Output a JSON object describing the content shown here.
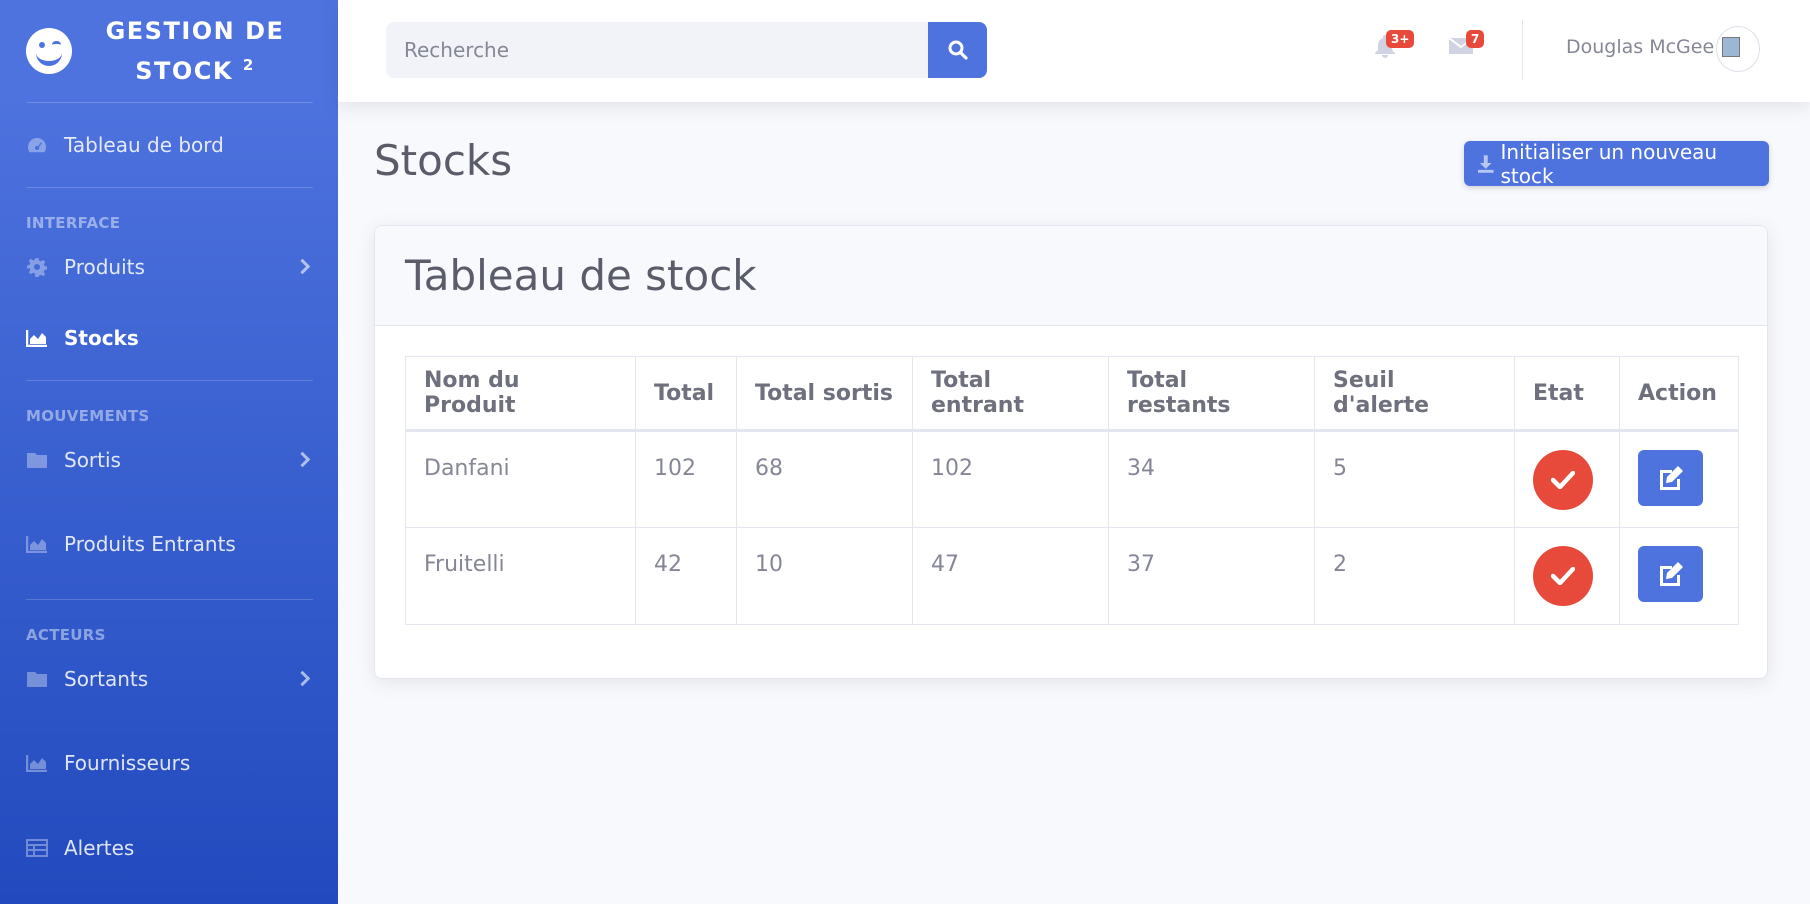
{
  "sidebar": {
    "brand": {
      "title": "GESTION DE STOCK",
      "sup": "2",
      "icon": "laugh-wink-icon"
    },
    "items": [
      {
        "label": "Tableau de bord",
        "icon": "tachometer-icon"
      },
      {
        "label": "Produits",
        "icon": "cog-icon"
      },
      {
        "label": "Stocks",
        "icon": "chart-area-icon"
      },
      {
        "label": "Sortis",
        "icon": "folder-icon"
      },
      {
        "label": "Produits Entrants",
        "icon": "chart-area-icon"
      },
      {
        "label": "Sortants",
        "icon": "folder-icon"
      },
      {
        "label": "Fournisseurs",
        "icon": "chart-area-icon"
      },
      {
        "label": "Alertes",
        "icon": "table-icon"
      }
    ],
    "headings": {
      "interface": "Interface",
      "mouvements": "Mouvements",
      "acteurs": "Acteurs"
    }
  },
  "topbar": {
    "search_placeholder": "Recherche",
    "alerts_badge": "3+",
    "messages_badge": "7",
    "user_name": "Douglas McGee"
  },
  "main": {
    "page_title": "Stocks",
    "init_button": "Initialiser un nouveau stock",
    "card_title": "Tableau de stock",
    "table": {
      "headers": [
        "Nom du Produit",
        "Total",
        "Total sortis",
        "Total entrant",
        "Total restants",
        "Seuil d'alerte",
        "Etat",
        "Action"
      ],
      "rows": [
        [
          "Danfani",
          "102",
          "68",
          "102",
          "34",
          "5"
        ],
        [
          "Fruitelli",
          "42",
          "10",
          "47",
          "37",
          "2"
        ]
      ]
    }
  },
  "colors": {
    "primary": "#4e73df",
    "danger": "#e74a3b",
    "sidebar_bottom": "#224abe"
  }
}
